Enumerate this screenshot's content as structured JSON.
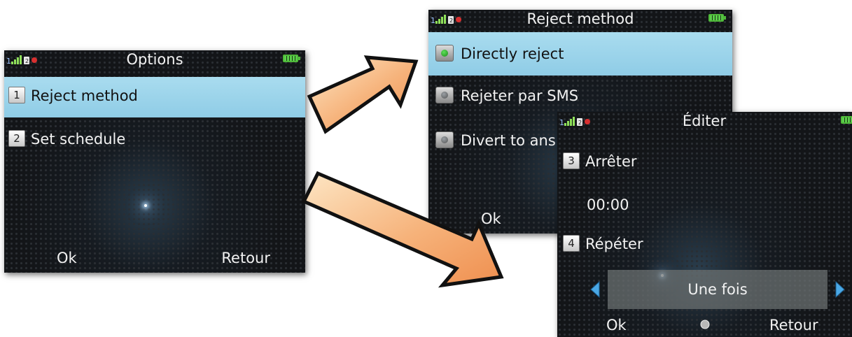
{
  "screens": {
    "options": {
      "title": "Options",
      "items": [
        {
          "num": "1",
          "label": "Reject method"
        },
        {
          "num": "2",
          "label": "Set schedule"
        }
      ],
      "softkey_left": "Ok",
      "softkey_right": "Retour"
    },
    "reject": {
      "title": "Reject method",
      "items": [
        {
          "label": "Directly reject",
          "selected": true
        },
        {
          "label": "Rejeter par SMS",
          "selected": false
        },
        {
          "label": "Divert to ans",
          "selected": false
        }
      ],
      "softkey_left": "Ok"
    },
    "edit": {
      "title": "Éditer",
      "rows": [
        {
          "num": "3",
          "label": "Arrêter"
        },
        {
          "value": "00:00"
        },
        {
          "num": "4",
          "label": "Répéter"
        }
      ],
      "selector_value": "Une fois",
      "softkey_left": "Ok",
      "softkey_right": "Retour"
    }
  },
  "colors": {
    "highlight": "#9ed6ec",
    "arrow_fill_light": "#fde0b8",
    "arrow_fill_dark": "#f3a060",
    "battery": "#5bd04a",
    "selector_arrows": "#4aa8e6"
  }
}
